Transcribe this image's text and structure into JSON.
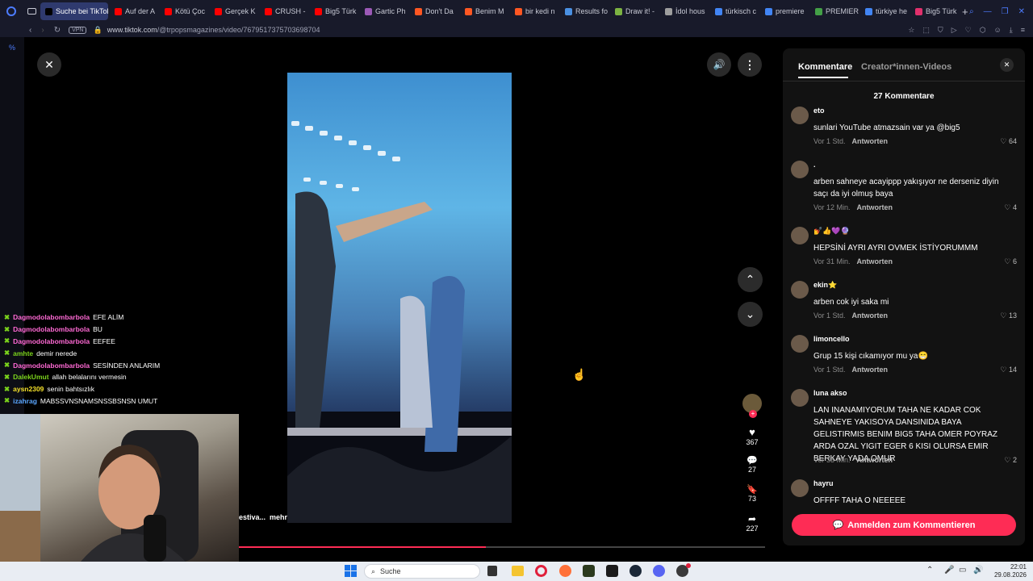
{
  "tabs": [
    {
      "label": "Suche bei TikTok",
      "color": "#000000",
      "active": true
    },
    {
      "label": "Auf der A",
      "color": "#ff0000"
    },
    {
      "label": "Kötü Çoc",
      "color": "#ff0000"
    },
    {
      "label": "Gerçek K",
      "color": "#ff0000"
    },
    {
      "label": "CRUSH -",
      "color": "#ff0000"
    },
    {
      "label": "Big5 Türk",
      "color": "#ff0000"
    },
    {
      "label": "Gartic Ph",
      "color": "#9b59b6"
    },
    {
      "label": "Don't Da",
      "color": "#ff5722"
    },
    {
      "label": "Benim M",
      "color": "#ff5722"
    },
    {
      "label": "bir kedi n",
      "color": "#ff5722"
    },
    {
      "label": "Results fo",
      "color": "#4a90e2"
    },
    {
      "label": "Draw it! -",
      "color": "#7cb342"
    },
    {
      "label": "İdol hous",
      "color": "#9e9e9e"
    },
    {
      "label": "türkisch c",
      "color": "#4285f4"
    },
    {
      "label": "premiere",
      "color": "#4285f4"
    },
    {
      "label": "PREMIER",
      "color": "#43a047"
    },
    {
      "label": "türkiye he",
      "color": "#4285f4"
    },
    {
      "label": "Big5 Türk",
      "color": "#e1306c"
    }
  ],
  "address": {
    "vpn": "VPN",
    "domain": "www.tiktok.com",
    "path": "/@trpopsmagazines/video/7679517375703698704"
  },
  "video": {
    "caption_left": "estiva...",
    "caption_more": "mehr",
    "likes": "367",
    "comments": "27",
    "saves": "73",
    "shares": "227",
    "progress_fraction": 0.47
  },
  "comments_panel": {
    "tab_comments": "Kommentare",
    "tab_creator": "Creator*innen-Videos",
    "count": "27 Kommentare",
    "reply_label": "Antworten",
    "items": [
      {
        "user": "eto",
        "text": "sunlari YouTube atmazsain var ya @big5",
        "time": "Vor 1 Std.",
        "likes": "64"
      },
      {
        "user": ".",
        "text": "arben sahneye acayippp yakışıyor ne derseniz diyin saçı da iyi olmuş baya",
        "time": "Vor 12 Min.",
        "likes": "4"
      },
      {
        "user": "💅👍💜🔮",
        "text": "HEPSİNİ AYRI AYRI OVMEK İSTİYORUMMM",
        "time": "Vor 31 Min.",
        "likes": "6"
      },
      {
        "user": "ekin⭐",
        "text": "arben cok iyi saka mi",
        "time": "Vor 1 Std.",
        "likes": "13"
      },
      {
        "user": "limoncello",
        "text": "Grup 15 kişi cıkamıyor mu ya😁",
        "time": "Vor 1 Std.",
        "likes": "14"
      },
      {
        "user": "luna akso",
        "text": "LAN INANAMIYORUM TAHA NE KADAR COK SAHNEYE YAKISOYA DANSINIDA BAYA GELISTIRMIS BENIM BIG5 TAHA OMER POYRAZ ARDA OZAL YIGIT EGER 6 KISI OLURSA EMIR BERKAY YADA OMUR",
        "time": "Vor 33 Min.",
        "likes": "2"
      },
      {
        "user": "hayru",
        "text": "OFFFF TAHA O NEEEEE",
        "time": "",
        "likes": ""
      }
    ],
    "login_button": "Anmelden zum Kommentieren"
  },
  "chat": [
    {
      "user": "Dagmodolabombarbola",
      "msg": "EFE ALİM",
      "color": "#ff69d4"
    },
    {
      "user": "Dagmodolabombarbola",
      "msg": "BU",
      "color": "#ff69d4"
    },
    {
      "user": "Dagmodolabombarbola",
      "msg": "EEFEE",
      "color": "#ff69d4"
    },
    {
      "user": "amhte",
      "msg": "demir nerede",
      "color": "#7bd31c"
    },
    {
      "user": "Dagmodolabombarbola",
      "msg": "SESİNDEN ANLARIM",
      "color": "#ff69d4"
    },
    {
      "user": "DalekUmut",
      "msg": "allah belalarını vermesin",
      "color": "#7bd31c"
    },
    {
      "user": "aysn2309",
      "msg": "senin bahtsızlık",
      "color": "#f5e12a"
    },
    {
      "user": "izahrag",
      "msg": "MABSSVNSNAMSNSSBSNSN UMUT",
      "color": "#5aa6ff"
    }
  ],
  "taskbar": {
    "search_placeholder": "Suche",
    "time": "22:01",
    "date": "29.08.2026"
  }
}
